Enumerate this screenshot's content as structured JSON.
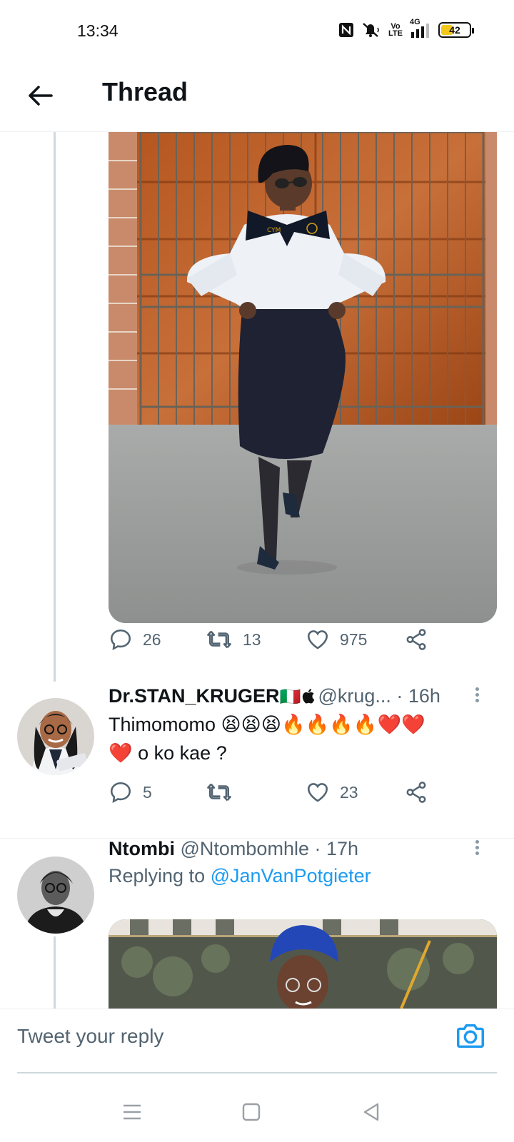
{
  "status_bar": {
    "time": "13:34",
    "icons": [
      "nfc-icon",
      "mute-icon",
      "volte-icon",
      "signal-4g-icon"
    ],
    "volte_label": "Vo LTE",
    "network_label": "4G",
    "battery": "42"
  },
  "header": {
    "back_icon": "arrow-left-icon",
    "title": "Thread"
  },
  "tweet1_actions": {
    "replies": "26",
    "retweets": "13",
    "likes": "975"
  },
  "tweets": [
    {
      "name": "Dr.STAN_KRUGER",
      "name_emoji": "🇮🇹",
      "handle": "@krug...",
      "time": "· 16h",
      "text_line1": "Thimomomo 😫😫😫🔥🔥🔥🔥❤️❤️",
      "text_line2": "❤️ o ko kae ?",
      "replies": "5",
      "retweets": "",
      "likes": "23"
    },
    {
      "name": "Ntombi",
      "handle": "@Ntombomhle",
      "time": "· 17h",
      "replying_prefix": "Replying to",
      "replying_to": "@JanVanPotgieter"
    }
  ],
  "composer": {
    "placeholder": "Tweet your reply",
    "camera_icon": "camera-icon"
  },
  "nav_bar": {
    "icons": [
      "menu-icon",
      "home-square-icon",
      "back-triangle-icon"
    ]
  },
  "colors": {
    "accent": "#1d9bf0",
    "secondary_text": "#536471",
    "thread_line": "#cfd9de"
  }
}
